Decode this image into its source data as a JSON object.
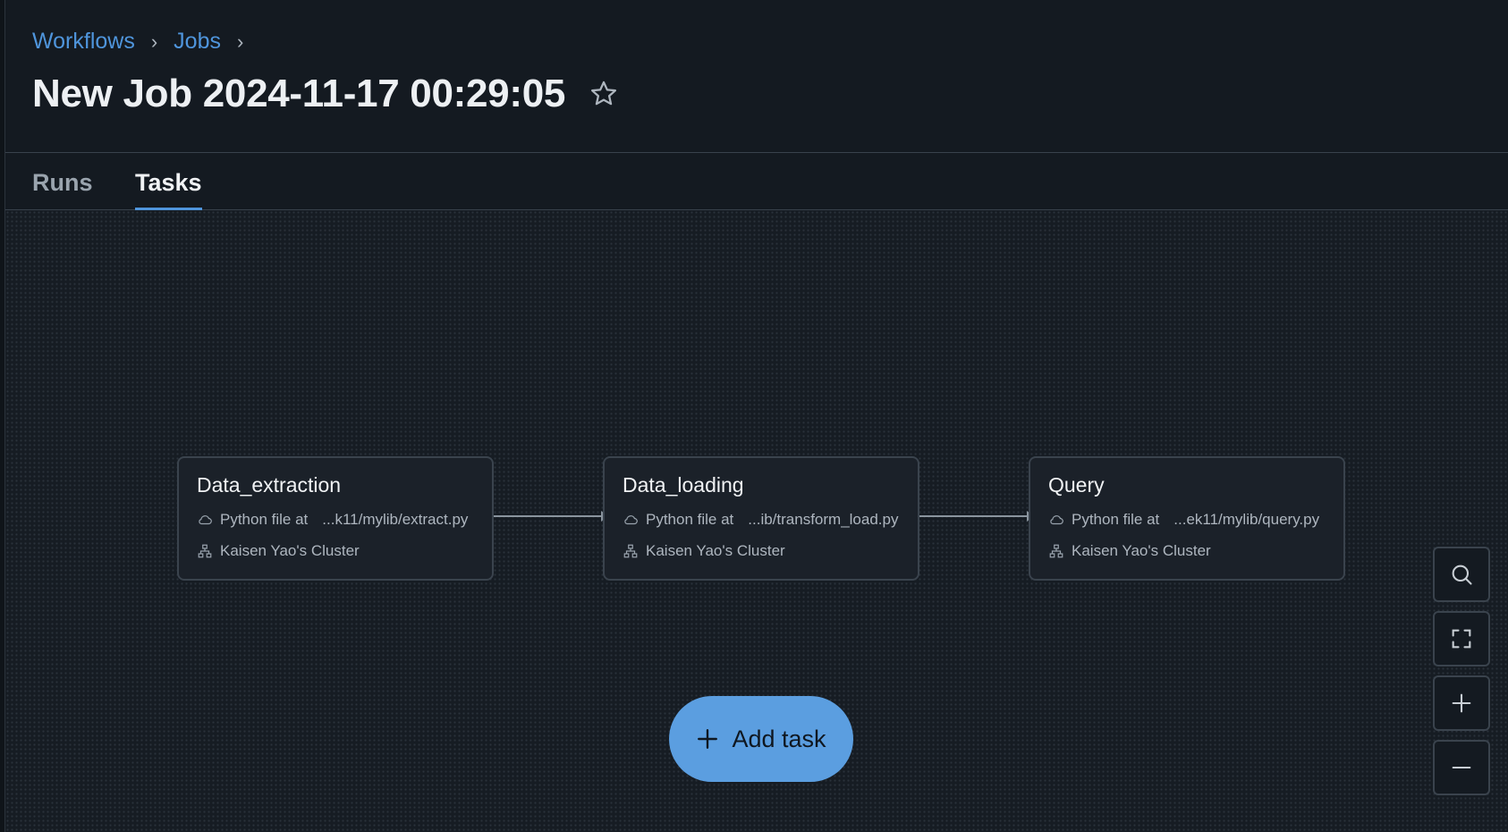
{
  "breadcrumb": {
    "items": [
      "Workflows",
      "Jobs"
    ],
    "separator": "›"
  },
  "job": {
    "title": "New Job 2024-11-17 00:29:05"
  },
  "tabs": [
    {
      "label": "Runs",
      "active": false
    },
    {
      "label": "Tasks",
      "active": true
    }
  ],
  "tasks": [
    {
      "name": "Data_extraction",
      "file_label": "Python file at",
      "file_path": "...k11/mylib/extract.py",
      "cluster": "Kaisen Yao's Cluster"
    },
    {
      "name": "Data_loading",
      "file_label": "Python file at",
      "file_path": "...ib/transform_load.py",
      "cluster": "Kaisen Yao's Cluster"
    },
    {
      "name": "Query",
      "file_label": "Python file at",
      "file_path": "...ek11/mylib/query.py",
      "cluster": "Kaisen Yao's Cluster"
    }
  ],
  "add_task": {
    "label": "Add task"
  },
  "controls": {
    "icons": [
      "search-icon",
      "fit-view-icon",
      "zoom-in-icon",
      "zoom-out-icon"
    ]
  },
  "colors": {
    "accent": "#5b9ee0",
    "link": "#4f95dc",
    "background": "#141a21",
    "card": "#1b2129"
  }
}
